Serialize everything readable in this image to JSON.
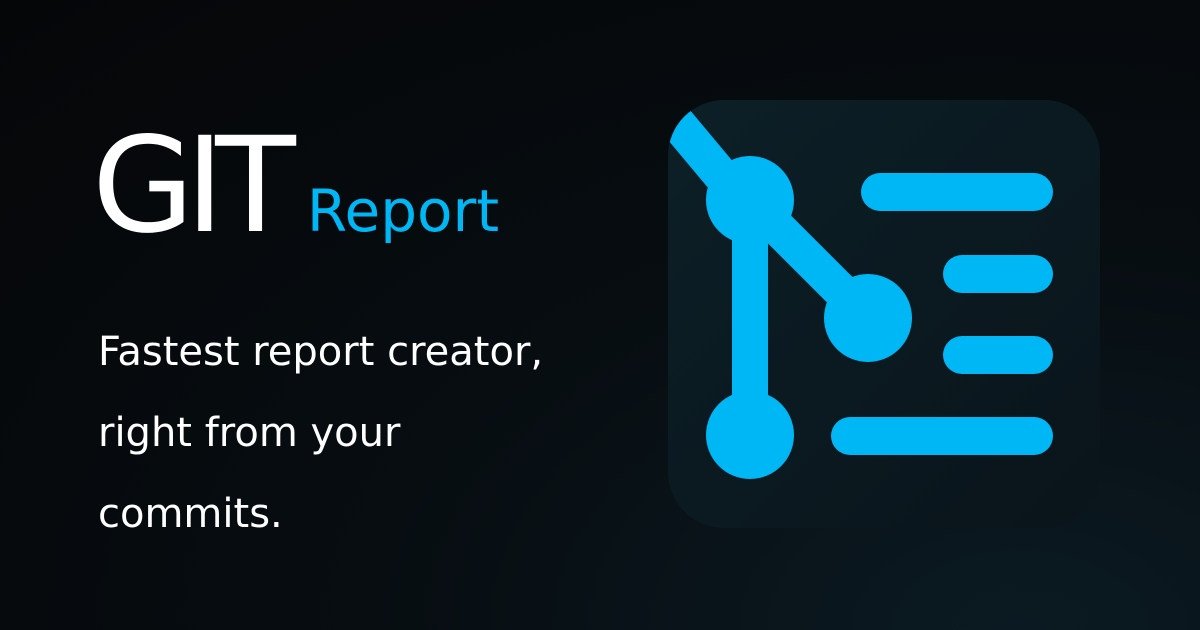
{
  "title": {
    "main": "GIT",
    "sub": "Report"
  },
  "tagline": {
    "line1": "Fastest report creator,",
    "line2": "right from your",
    "line3": "commits."
  },
  "logo": {
    "icon": "git-branch-list-icon",
    "accent_color": "#00b7f5",
    "tile_color": "#0b1c24"
  }
}
